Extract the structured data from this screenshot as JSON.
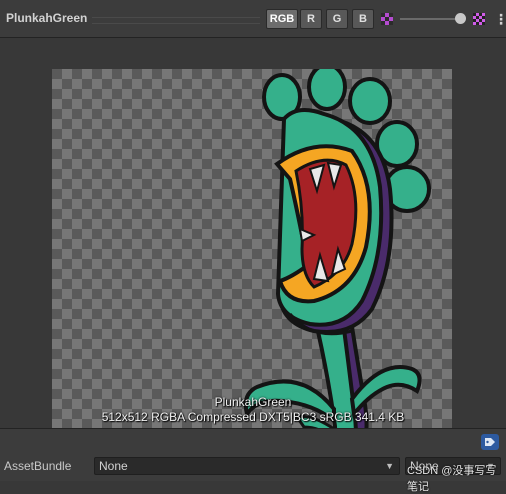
{
  "header": {
    "title": "PlunkahGreen",
    "channels": [
      "RGB",
      "R",
      "G",
      "B"
    ],
    "active_channel": "RGB",
    "icons": [
      "alpha-toggle-icon",
      "mip-slider",
      "mip-checker-icon",
      "more-menu-icon"
    ]
  },
  "preview": {
    "asset_name": "PlunkahGreen",
    "asset_info": "512x512  RGBA Compressed DXT5|BC3 sRGB  341.4 KB"
  },
  "bottom": {
    "assetbundle_label": "AssetBundle",
    "bundle_name": "None",
    "bundle_variant": "None",
    "watermark": "CSDN @没事写写笔记"
  },
  "colors": {
    "monster_green": "#35b08b",
    "mouth_red": "#a62226",
    "lip_orange": "#f5a623",
    "outline": "#141414"
  }
}
